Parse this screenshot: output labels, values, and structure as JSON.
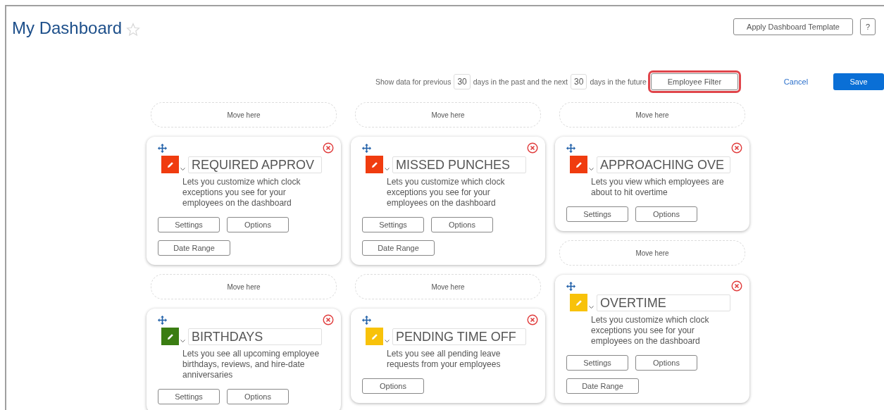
{
  "header": {
    "title": "My Dashboard",
    "favorite": false,
    "buttons": [
      {
        "label": "Apply Dashboard Template",
        "kind": "text"
      },
      {
        "label": "?",
        "kind": "help"
      }
    ]
  },
  "range": {
    "prefix": "Show data for previous",
    "past_days": "30",
    "middle": "days in the past and the next",
    "future_days": "30",
    "suffix": "days in the future",
    "filter_button": {
      "label": "Employee Filter",
      "highlighted": true
    }
  },
  "actions": {
    "cancel": "Cancel",
    "save": "Save"
  },
  "columns": [
    {
      "items": [
        {
          "kind": "dropzone",
          "label": "Move here"
        },
        {
          "kind": "widget",
          "title": "REQUIRED APPROV",
          "color": "#f03c0f",
          "description": "Lets you customize which clock exceptions you see for your employees on the dashboard",
          "buttons": [
            "Settings",
            "Options",
            "Date Range"
          ]
        },
        {
          "kind": "dropzone",
          "label": "Move here"
        },
        {
          "kind": "widget",
          "title": "BIRTHDAYS",
          "color": "#3a7d12",
          "description": "Lets you see all upcoming employee birthdays, reviews, and hire-date anniversaries",
          "buttons": [
            "Settings",
            "Options"
          ]
        }
      ]
    },
    {
      "items": [
        {
          "kind": "dropzone",
          "label": "Move here"
        },
        {
          "kind": "widget",
          "title": "MISSED PUNCHES",
          "color": "#f03c0f",
          "description": "Lets you customize which clock exceptions you see for your employees on the dashboard",
          "buttons": [
            "Settings",
            "Options",
            "Date Range"
          ]
        },
        {
          "kind": "dropzone",
          "label": "Move here"
        },
        {
          "kind": "widget",
          "title": "PENDING TIME OFF",
          "color": "#f8c20a",
          "description": "Lets you see all pending leave requests from your employees",
          "buttons": [
            "Options"
          ]
        }
      ]
    },
    {
      "items": [
        {
          "kind": "dropzone",
          "label": "Move here"
        },
        {
          "kind": "widget",
          "title": "APPROACHING OVE",
          "color": "#f03c0f",
          "description": "Lets you view which employees are about to hit overtime",
          "buttons": [
            "Settings",
            "Options"
          ]
        },
        {
          "kind": "dropzone",
          "label": "Move here"
        },
        {
          "kind": "widget",
          "title": "OVERTIME",
          "color": "#f8c20a",
          "description": "Lets you customize which clock exceptions you see for your employees on the dashboard",
          "buttons": [
            "Settings",
            "Options",
            "Date Range"
          ]
        }
      ]
    }
  ]
}
